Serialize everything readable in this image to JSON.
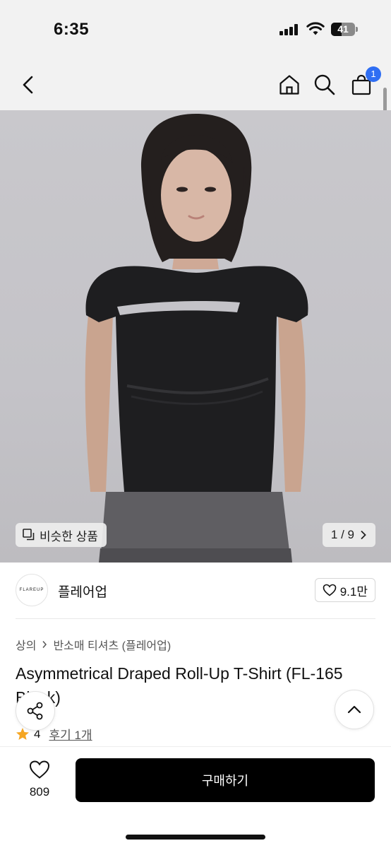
{
  "status": {
    "time": "6:35",
    "battery": "41"
  },
  "nav": {
    "cart_count": "1"
  },
  "hero": {
    "similar_label": "비슷한 상품",
    "page_indicator": "1 / 9"
  },
  "seller": {
    "logo_text": "FLAREUP",
    "name": "플레어업",
    "likes": "9.1만"
  },
  "breadcrumb": {
    "category": "상의",
    "subcategory": "반소매 티셔츠 (플레어업)"
  },
  "product": {
    "title": "Asymmetrical Draped Roll-Up T-Shirt (FL-165 Black)",
    "rating": "4",
    "reviews": "후기 1개"
  },
  "bottom": {
    "wish_count": "809",
    "buy_label": "구매하기"
  },
  "colors": {
    "accent": "#2f6ef3",
    "rating_star": "#f5a623",
    "buy_button": "#000000"
  }
}
